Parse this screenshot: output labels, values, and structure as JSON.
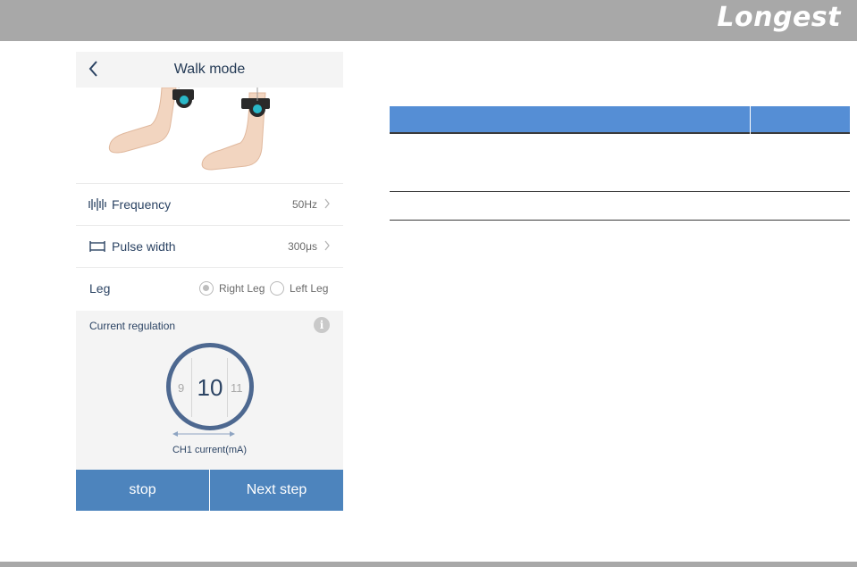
{
  "brand": {
    "name": "Longest"
  },
  "header": {
    "title": "Walk mode"
  },
  "settings": {
    "frequency": {
      "label": "Frequency",
      "value": "50Hz"
    },
    "pulse_width": {
      "label": "Pulse width",
      "value": "300μs"
    },
    "leg": {
      "label": "Leg",
      "options": [
        "Right Leg",
        "Left Leg"
      ],
      "selected": "Right Leg"
    }
  },
  "current": {
    "title": "Current regulation",
    "info_icon": "i",
    "prev": "9",
    "value": "10",
    "next": "11",
    "channel_label": "CH1 current(mA)"
  },
  "buttons": {
    "stop": "stop",
    "next": "Next step"
  },
  "colors": {
    "accent": "#4d84bd",
    "dial": "#4d6890",
    "table_header": "#558ed5",
    "band": "#a8a8a8"
  },
  "icons": [
    "back-icon",
    "frequency-icon",
    "pulse-width-icon",
    "chevron-right-icon",
    "info-icon"
  ]
}
